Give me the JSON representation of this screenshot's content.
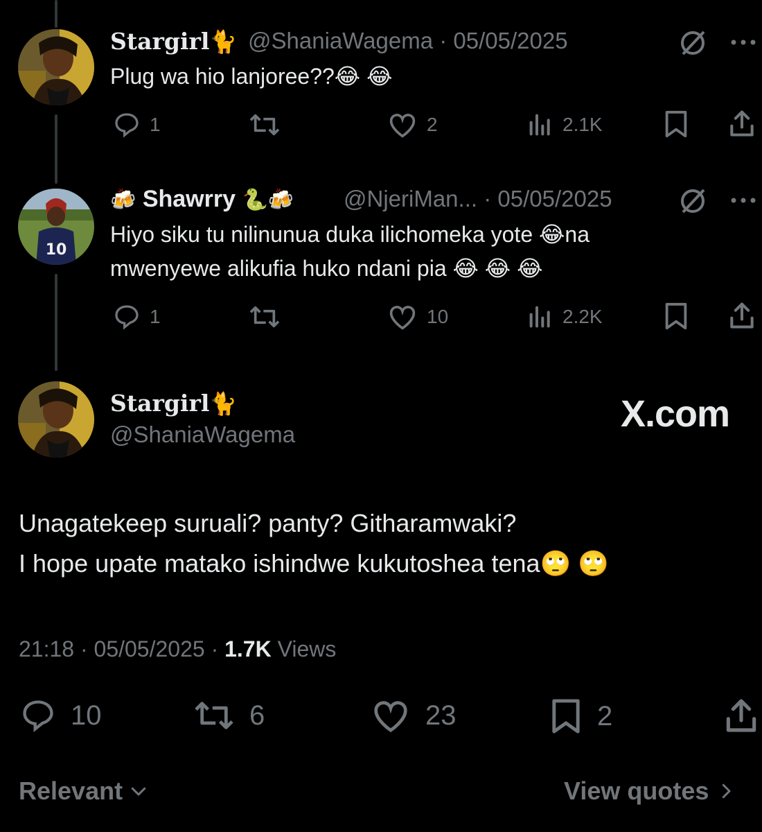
{
  "replies": [
    {
      "display_name": "Stargirl",
      "name_emoji": "🐈",
      "handle": "@ShaniaWagema",
      "separator": "·",
      "date": "05/05/2025",
      "text": "Plug wa hio lanjoree??",
      "text_emoji": [
        "😂",
        "😂"
      ],
      "stats": {
        "replies": "1",
        "reposts": "",
        "likes": "2",
        "views": "2.1K"
      }
    },
    {
      "display_name": "Shawrry",
      "name_emoji_prefix": "🍻",
      "name_emoji_suffix": "🐍🍻",
      "handle": "@NjeriMan...",
      "separator": "·",
      "date": "05/05/2025",
      "text_line1": "Hiyo siku tu nilinunua duka ilichomeka yote",
      "text_line1_end": "na",
      "text_line2": "mwenyewe alikufia huko ndani pia",
      "text_emoji": [
        "😂",
        "😂",
        "😂",
        "😂"
      ],
      "stats": {
        "replies": "1",
        "reposts": "",
        "likes": "10",
        "views": "2.2K"
      }
    }
  ],
  "main_post": {
    "display_name": "Stargirl",
    "name_emoji": "🐈",
    "handle": "@ShaniaWagema",
    "watermark": "X.com",
    "text_line1": "Unagatekeep suruali? panty? Githaramwaki?",
    "text_line2": "I hope upate matako ishindwe kukutoshea tena",
    "text_emoji": [
      "🙄",
      "🙄"
    ],
    "time": "21:18",
    "separator": "·",
    "date": "05/05/2025",
    "views_count": "1.7K",
    "views_label": "Views",
    "stats": {
      "replies": "10",
      "reposts": "6",
      "likes": "23",
      "bookmarks": "2"
    }
  },
  "footer": {
    "sort_label": "Relevant",
    "quotes_label": "View quotes"
  },
  "icons": {
    "reply": "reply-icon",
    "repost": "repost-icon",
    "like": "heart-icon",
    "views": "views-icon",
    "bookmark": "bookmark-icon",
    "share": "share-icon",
    "grok": "grok-icon",
    "more": "more-icon"
  },
  "colors": {
    "background": "#000000",
    "text": "#e7e9ea",
    "secondary": "#71767b",
    "thread_line": "#333639"
  }
}
